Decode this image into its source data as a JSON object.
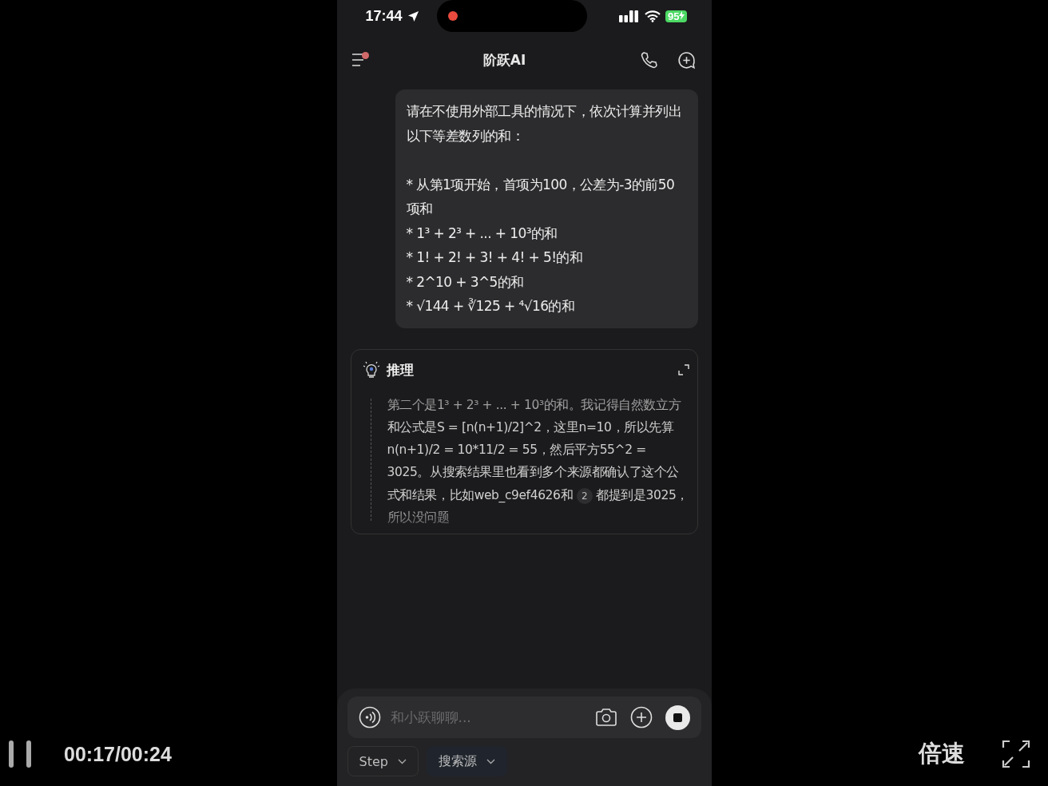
{
  "status_bar": {
    "time": "17:44",
    "recording": true,
    "battery": "95",
    "charging": true
  },
  "header": {
    "title": "阶跃AI",
    "menu_badge": true
  },
  "user_message": {
    "intro": "请在不使用外部工具的情况下，依次计算并列出以下等差数列的和：",
    "bullets": [
      "* 从第1项开始，首项为100，公差为-3的前50项和",
      "* 1³ + 2³ + ... + 10³的和",
      "* 1! + 2! + 3! + 4! + 5!的和",
      "* 2^10 + 3^5的和",
      "* √144 + ∛125 + ⁴√16的和"
    ]
  },
  "reasoning": {
    "title": "推理",
    "parts": [
      {
        "kind": "text",
        "text": "第二个是1³ + 2³ + ... + 10³的和。我记得自然数立方和公式是S = [n(n+1)/2]^2，这里n=10，所以先算n(n+1)/2 = 10*11/2 = 55，然后平方55^2 = 3025。从搜索结果里也看到多个来源都确认了这个公式和结果，比如web_c9ef4626和 "
      },
      {
        "kind": "citation",
        "text": "2"
      },
      {
        "kind": "text",
        "text": " 都提到是3025，所以没问题"
      }
    ]
  },
  "composer": {
    "placeholder": "和小跃聊聊...",
    "generating": true,
    "chips": [
      {
        "label": "Step",
        "selected": false
      },
      {
        "label": "搜索源",
        "selected": true
      }
    ]
  },
  "player": {
    "playing": true,
    "time": "00:17/00:24",
    "speed": "倍速"
  }
}
